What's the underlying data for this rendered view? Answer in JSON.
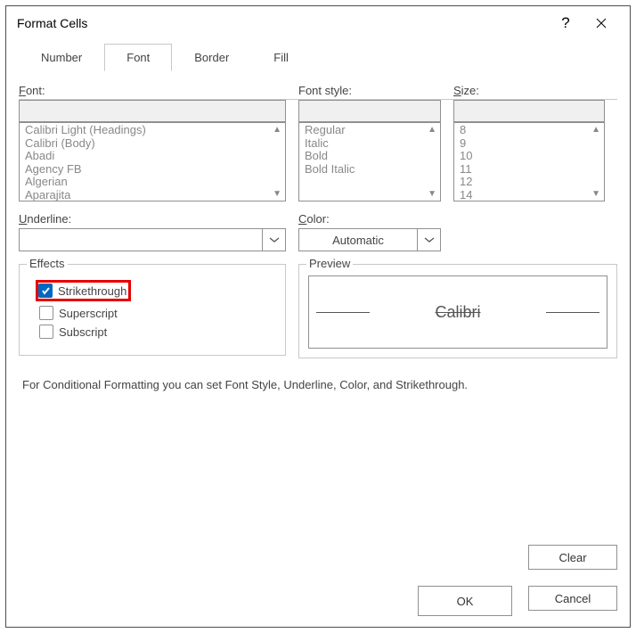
{
  "title": "Format Cells",
  "tabs": [
    "Number",
    "Font",
    "Border",
    "Fill"
  ],
  "active_tab": "Font",
  "labels": {
    "font": "Font:",
    "font_style": "Font style:",
    "size": "Size:",
    "underline": "Underline:",
    "color": "Color:",
    "effects": "Effects",
    "preview": "Preview"
  },
  "fonts": [
    "Calibri Light (Headings)",
    "Calibri (Body)",
    "Abadi",
    "Agency FB",
    "Algerian",
    "Aparajita"
  ],
  "font_styles": [
    "Regular",
    "Italic",
    "Bold",
    "Bold Italic"
  ],
  "sizes": [
    "8",
    "9",
    "10",
    "11",
    "12",
    "14"
  ],
  "color_value": "Automatic",
  "effects": {
    "strikethrough": "Strikethrough",
    "superscript": "Superscript",
    "subscript": "Subscript"
  },
  "preview_text": "Calibri",
  "note": "For Conditional Formatting you can set Font Style, Underline, Color, and Strikethrough.",
  "buttons": {
    "clear": "Clear",
    "ok": "OK",
    "cancel": "Cancel"
  }
}
